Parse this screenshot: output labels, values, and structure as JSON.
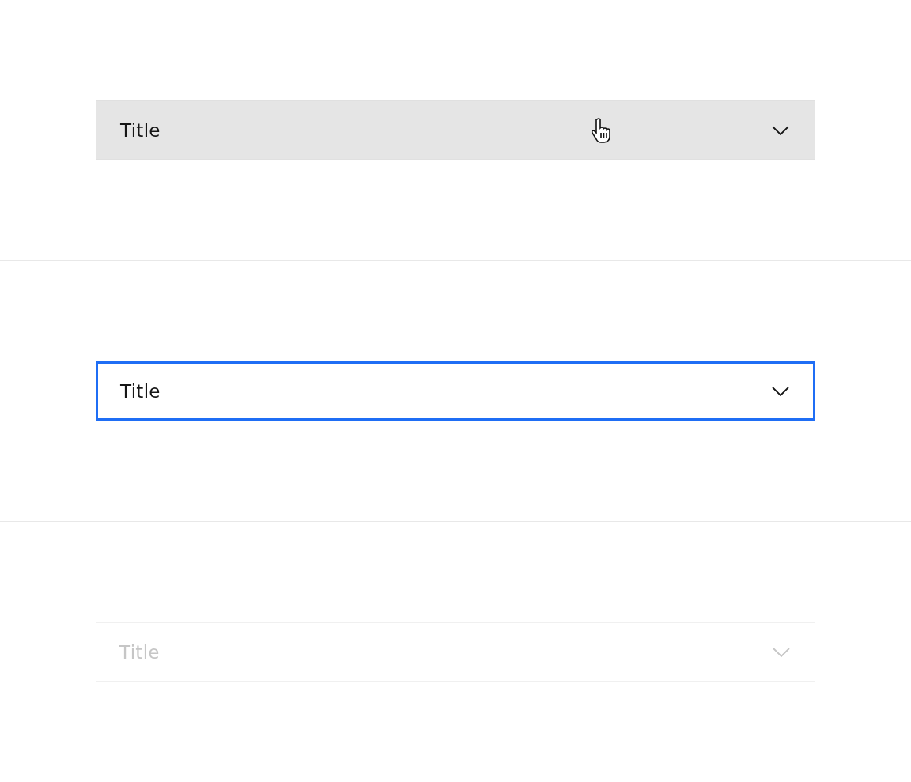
{
  "accordions": [
    {
      "title": "Title",
      "hovered": true,
      "focused": false,
      "disabled": false
    },
    {
      "title": "Title",
      "hovered": false,
      "focused": true,
      "disabled": false
    },
    {
      "title": "Title",
      "hovered": false,
      "focused": false,
      "disabled": true
    }
  ]
}
